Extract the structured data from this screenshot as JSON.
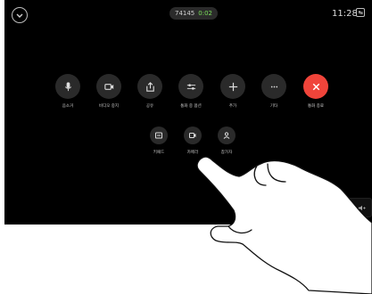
{
  "header": {
    "collapse_icon": "chevron-down-icon",
    "call_number": "74145",
    "call_duration": "0:02",
    "clock": "11:28",
    "mini_icon_text": "↹"
  },
  "controls": {
    "row1": [
      {
        "name": "mute",
        "icon": "microphone-icon",
        "label": "음소거"
      },
      {
        "name": "stop-video",
        "icon": "camera-icon",
        "label": "비디오 중지"
      },
      {
        "name": "share",
        "icon": "share-icon",
        "label": "공유"
      },
      {
        "name": "settings",
        "icon": "sliders-icon",
        "label": "통화 중 옵션"
      },
      {
        "name": "add",
        "icon": "plus-icon",
        "label": "추가"
      },
      {
        "name": "more",
        "icon": "ellipsis-icon",
        "label": "기타"
      },
      {
        "name": "end-call",
        "icon": "close-icon",
        "label": "통화 종료"
      }
    ],
    "row2": [
      {
        "name": "keypad",
        "icon": "keypad-icon",
        "label": "키패드"
      },
      {
        "name": "camera-control",
        "icon": "camera-control-icon",
        "label": "카메라"
      },
      {
        "name": "participants",
        "icon": "person-icon",
        "label": "참가자"
      }
    ]
  },
  "volume": {
    "down_icon": "volume-down-icon",
    "up_icon": "volume-up-icon"
  },
  "colors": {
    "end_call": "#f0443a",
    "button_bg": "#2a2a2a",
    "duration": "#7adf5a"
  }
}
